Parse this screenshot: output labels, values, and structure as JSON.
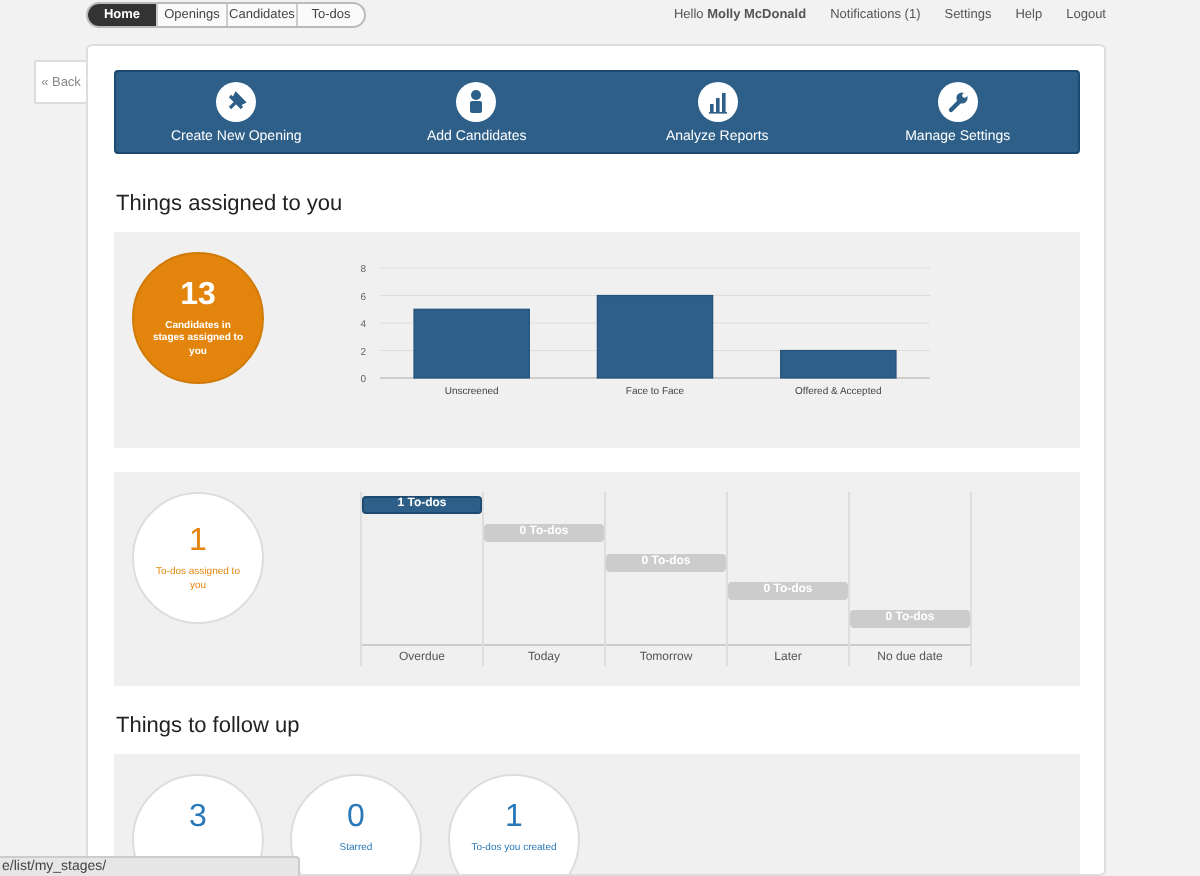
{
  "nav": {
    "tabs": [
      {
        "label": "Home",
        "selected": true
      },
      {
        "label": "Openings",
        "selected": false
      },
      {
        "label": "Candidates",
        "selected": false
      },
      {
        "label": "To-dos",
        "selected": false
      }
    ],
    "greeting": "Hello **Molly McDonald**",
    "links": [
      "Notifications (1)",
      "Settings",
      "Help",
      "Logout"
    ]
  },
  "back_button": "« Back",
  "actions": [
    {
      "kind": "pin",
      "label": "Create New Opening"
    },
    {
      "kind": "person",
      "label": "Add Candidates"
    },
    {
      "kind": "report",
      "label": "Analyze Reports"
    },
    {
      "kind": "wrench",
      "label": "Manage Settings"
    }
  ],
  "assigned": {
    "heading": "Things assigned to you",
    "candidates": {
      "value": "13",
      "label": "Candidates in stages assigned to you"
    },
    "chart_data": {
      "type": "bar",
      "categories": [
        "Unscreened",
        "Face to Face",
        "Offered & Accepted"
      ],
      "values": [
        5,
        6,
        2
      ],
      "ylim": [
        0,
        8
      ],
      "yticks": [
        0,
        2,
        4,
        6,
        8
      ],
      "grid": true
    },
    "todos": {
      "value": "1",
      "label": "To-dos assigned to you"
    },
    "timeline": [
      {
        "label": "Overdue",
        "count": "1 To-dos",
        "selected": true
      },
      {
        "label": "Today",
        "count": "0 To-dos",
        "selected": false
      },
      {
        "label": "Tomorrow",
        "count": "0 To-dos",
        "selected": false
      },
      {
        "label": "Later",
        "count": "0 To-dos",
        "selected": false
      },
      {
        "label": "No due date",
        "count": "0 To-dos",
        "selected": false
      }
    ]
  },
  "follow_up": {
    "heading": "Things to follow up",
    "items": [
      {
        "value": "3"
      },
      {
        "value": "0",
        "label": "Starred"
      },
      {
        "value": "1",
        "label": "To-dos you created"
      }
    ]
  },
  "status_url": "e/list/my_stages/"
}
